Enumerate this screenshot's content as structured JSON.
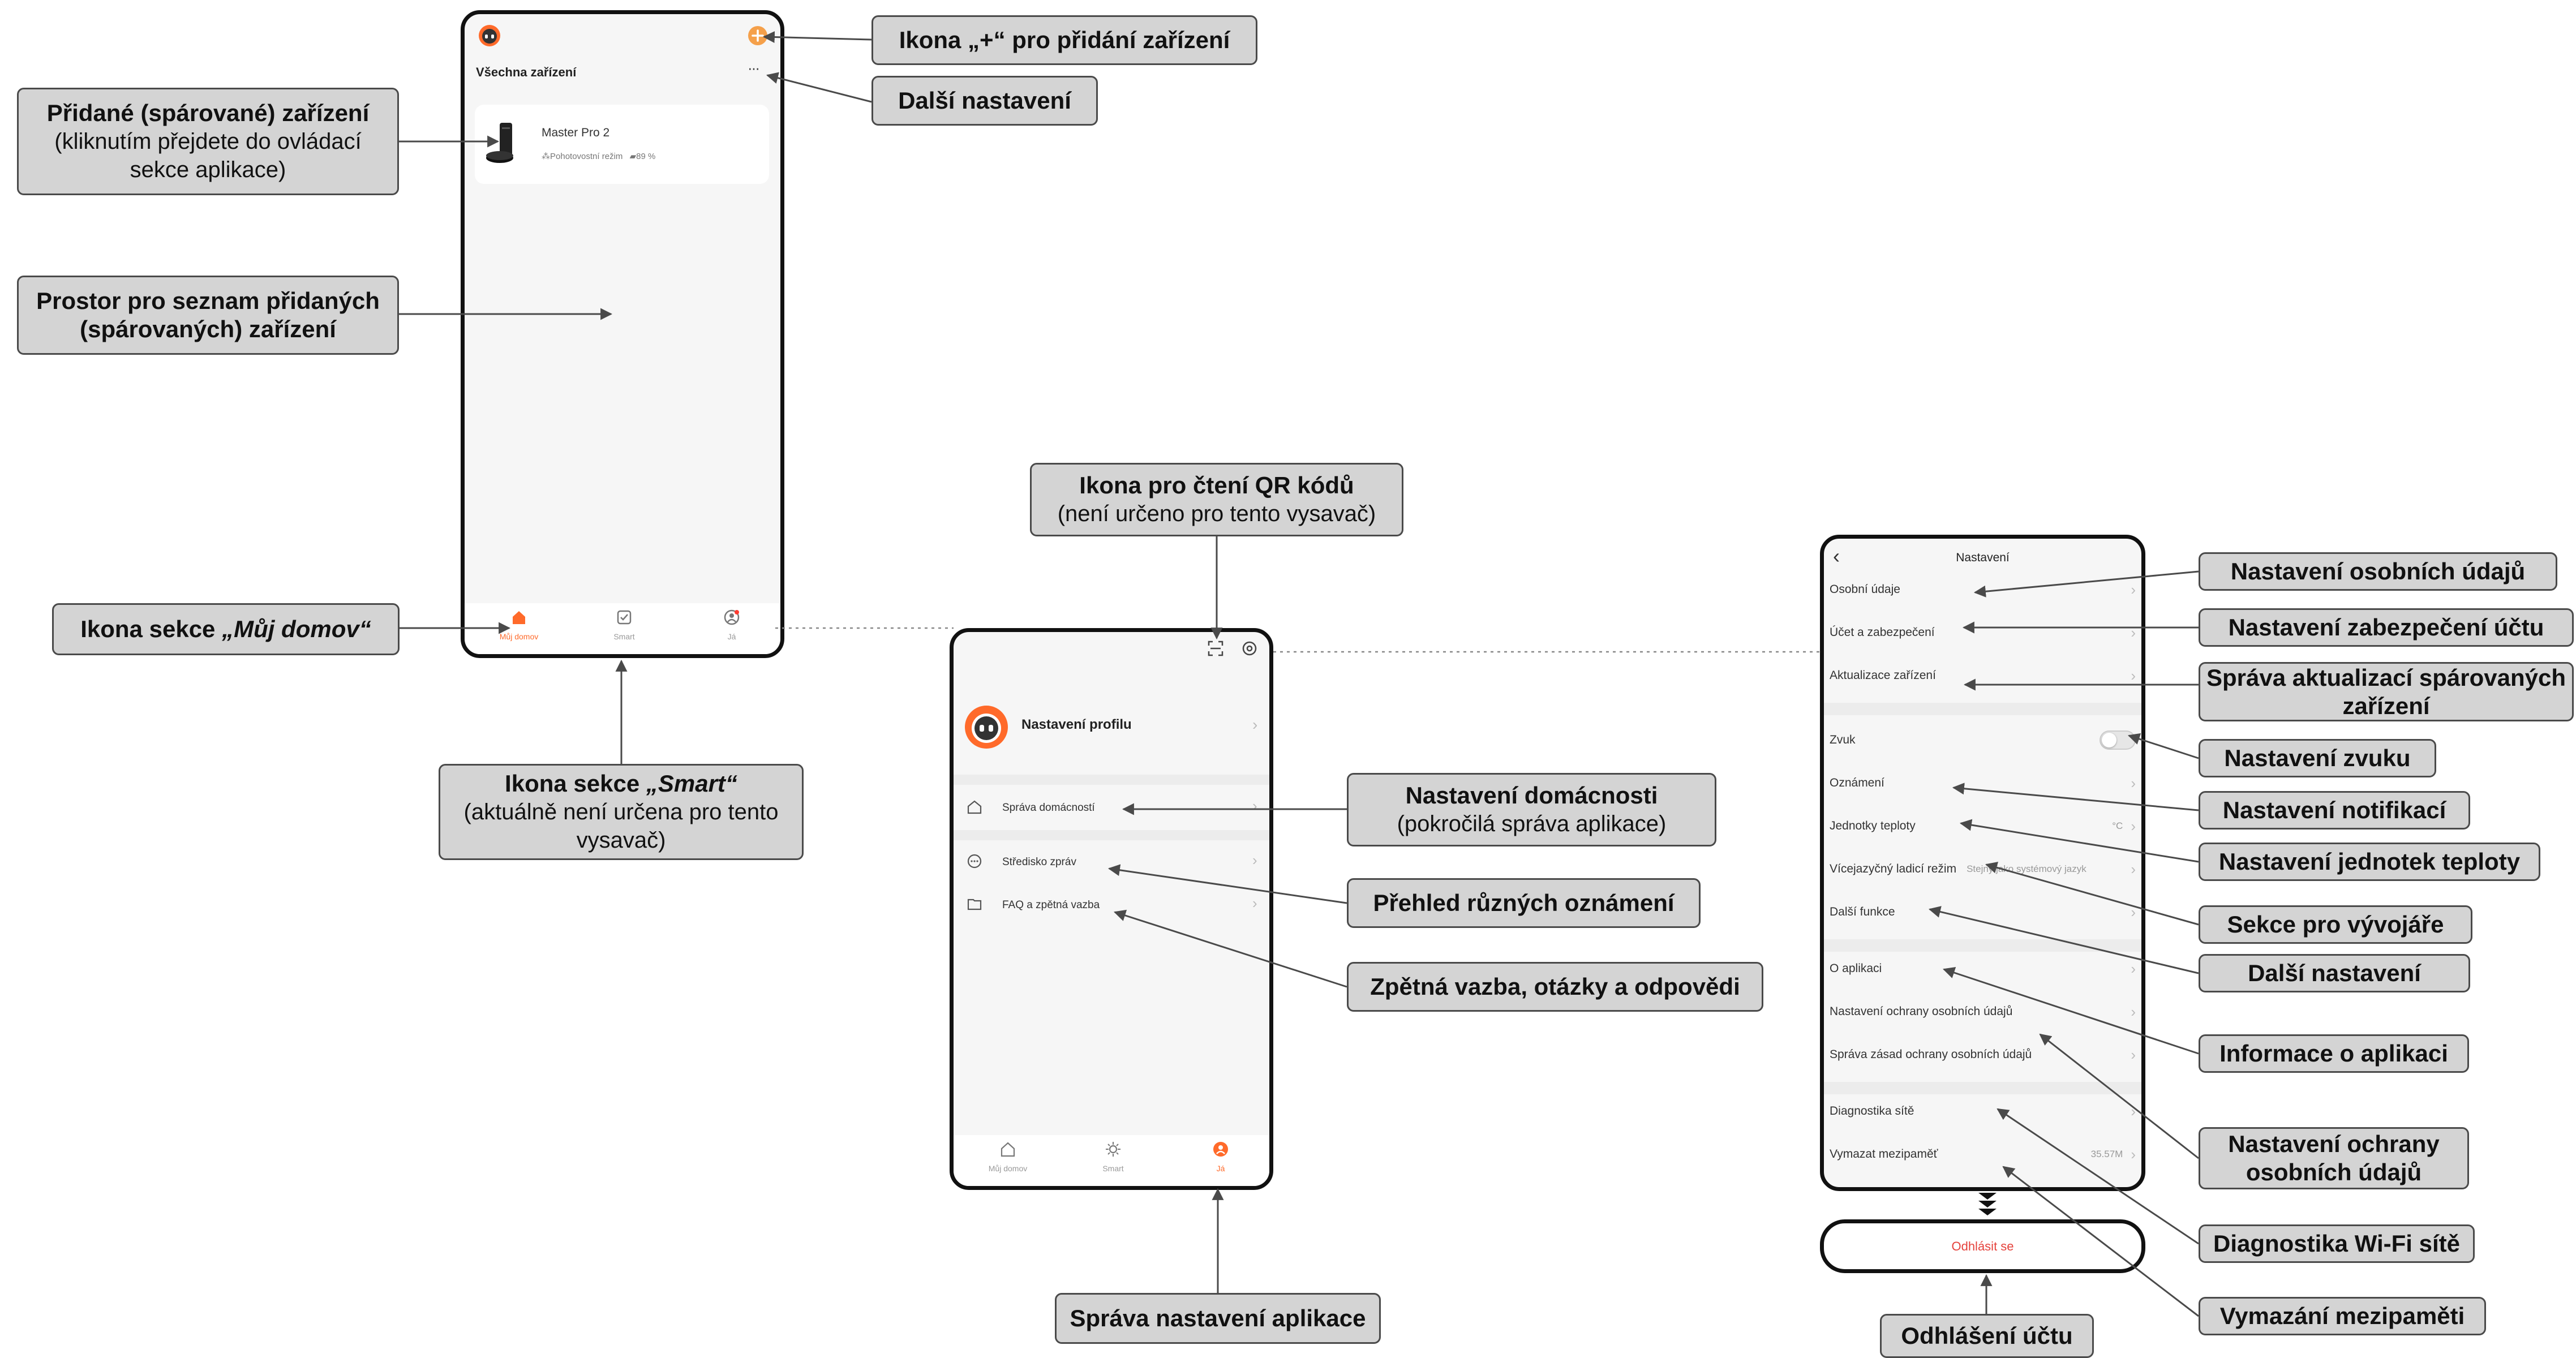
{
  "phone1": {
    "header_title": "Všechna zařízení",
    "more_dots": "···",
    "device": {
      "name": "Master Pro 2",
      "status": "Pohotovostní režim",
      "battery": "89 %"
    },
    "tabs": [
      {
        "label": "Můj domov"
      },
      {
        "label": "Smart"
      },
      {
        "label": "Já"
      }
    ]
  },
  "phone2": {
    "profile_label": "Nastavení  profilu",
    "items": [
      "Správa domácností",
      "Středisko zpráv",
      "FAQ a zpětná vazba"
    ],
    "tabs": [
      {
        "label": "Můj domov"
      },
      {
        "label": "Smart"
      },
      {
        "label": "Já"
      }
    ]
  },
  "phone3": {
    "title": "Nastavení",
    "back": "‹",
    "rows": [
      {
        "label": "Osobní údaje",
        "value": ""
      },
      {
        "label": "Účet a zabezpečení",
        "value": ""
      },
      {
        "label": "Aktualizace zařízení",
        "value": ""
      },
      {
        "label": "Zvuk",
        "value": ""
      },
      {
        "label": "Oznámení",
        "value": ""
      },
      {
        "label": "Jednotky teploty",
        "value": "°C"
      },
      {
        "label": "Vícejazyčný ladicí režim",
        "value": "Stejný jako systémový jazyk"
      },
      {
        "label": "Další funkce",
        "value": ""
      },
      {
        "label": "O aplikaci",
        "value": ""
      },
      {
        "label": "Nastavení ochrany osobních údajů",
        "value": ""
      },
      {
        "label": "Správa zásad ochrany osobních údajů",
        "value": ""
      },
      {
        "label": "Diagnostika sítě",
        "value": ""
      },
      {
        "label": "Vymazat mezipaměť",
        "value": "35.57M"
      }
    ],
    "sound_toggle_on": false,
    "scroll_hint": "⌄",
    "logout": "Odhlásit se"
  },
  "callouts": {
    "add_icon": {
      "bold": "Ikona „+“ pro přidání zařízení"
    },
    "more_settings_1": {
      "bold": "Další nastavení"
    },
    "paired_device": {
      "bold": "Přidané (spárované) zařízení",
      "normal1": "(kliknutím přejdete do ovládací",
      "normal2": "sekce aplikace)"
    },
    "device_list_space": {
      "bold1": "Prostor pro seznam přidaných",
      "bold2": "(spárovaných) zařízení"
    },
    "home_icon": {
      "bold_prefix": "Ikona sekce ",
      "bold_italic": "„Můj domov“"
    },
    "smart_icon": {
      "bold_prefix": "Ikona sekce ",
      "bold_italic": "„Smart“",
      "normal1": "(aktuálně není určena pro tento",
      "normal2": "vysavač)"
    },
    "qr_icon": {
      "bold": "Ikona pro čtení QR kódů",
      "normal": "(není určeno pro tento vysavač)"
    },
    "home_settings": {
      "bold": "Nastavení domácnosti",
      "normal": "(pokročilá správa aplikace)"
    },
    "notifications_overview": {
      "bold": "Přehled různých oznámení"
    },
    "feedback": {
      "bold": "Zpětná vazba, otázky a odpovědi"
    },
    "app_settings": {
      "bold": "Správa nastavení aplikace"
    },
    "personal_data": {
      "bold": "Nastavení osobních údajů"
    },
    "account_security": {
      "bold": "Nastavení zabezpečení účtu"
    },
    "device_updates": {
      "bold1": "Správa aktualizací spárovaných",
      "bold2": "zařízení"
    },
    "sound": {
      "bold": "Nastavení zvuku"
    },
    "notifications": {
      "bold": "Nastavení notifikací"
    },
    "temperature": {
      "bold": "Nastavení jednotek teploty"
    },
    "developers": {
      "bold": "Sekce pro vývojáře"
    },
    "more_settings_2": {
      "bold": "Další nastavení"
    },
    "about": {
      "bold": "Informace o aplikaci"
    },
    "privacy": {
      "bold1": "Nastavení ochrany",
      "bold2": "osobních údajů"
    },
    "wifi_diag": {
      "bold": "Diagnostika Wi-Fi sítě"
    },
    "clear_cache": {
      "bold": "Vymazání mezipaměti"
    },
    "logout_account": {
      "bold": "Odhlášení účtu"
    }
  },
  "colors": {
    "accent": "#ff6a2a",
    "callout_bg": "#d4d4d4",
    "logout": "#e5413b"
  }
}
